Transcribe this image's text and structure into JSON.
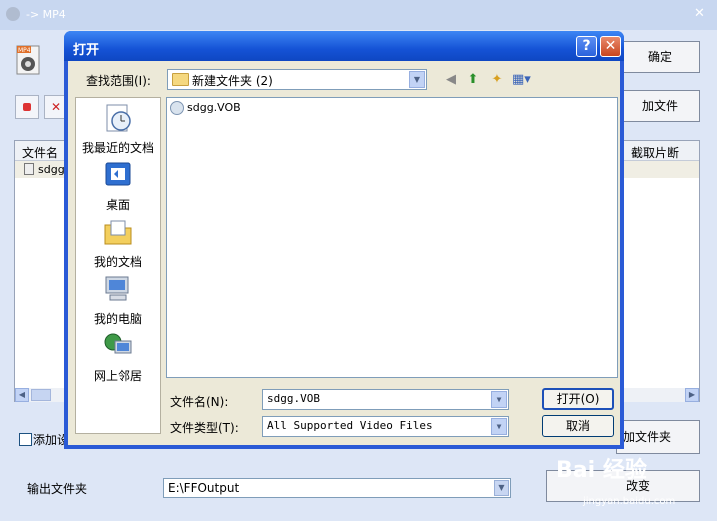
{
  "background_window": {
    "title": "-> MP4",
    "column_file_name": "文件名",
    "column_clip": "截取片断",
    "list_row_name": "sdgg.",
    "confirm_button": "确定",
    "add_file_button": "加文件",
    "add_checkbox_label": "添加设",
    "add_folder_button": "加文件夹",
    "output_folder_label": "输出文件夹",
    "output_folder_value": "E:\\FFOutput",
    "change_button": "改变"
  },
  "dialog": {
    "title": "打开",
    "look_in_label": "查找范围(I):",
    "look_in_value": "新建文件夹 (2)",
    "places": [
      {
        "label": "我最近的文档",
        "icon": "recent-documents-icon"
      },
      {
        "label": "桌面",
        "icon": "desktop-icon"
      },
      {
        "label": "我的文档",
        "icon": "my-documents-icon"
      },
      {
        "label": "我的电脑",
        "icon": "my-computer-icon"
      },
      {
        "label": "网上邻居",
        "icon": "network-places-icon"
      }
    ],
    "files": [
      {
        "name": "sdgg.VOB",
        "icon": "vob-file-icon"
      }
    ],
    "file_name_label": "文件名(N):",
    "file_name_value": "sdgg.VOB",
    "file_type_label": "文件类型(T):",
    "file_type_value": "All Supported Video Files",
    "open_button": "打开(O)",
    "cancel_button": "取消"
  },
  "watermark": {
    "text": "Bai 经验",
    "sub": "jingyan.baidu.com"
  }
}
